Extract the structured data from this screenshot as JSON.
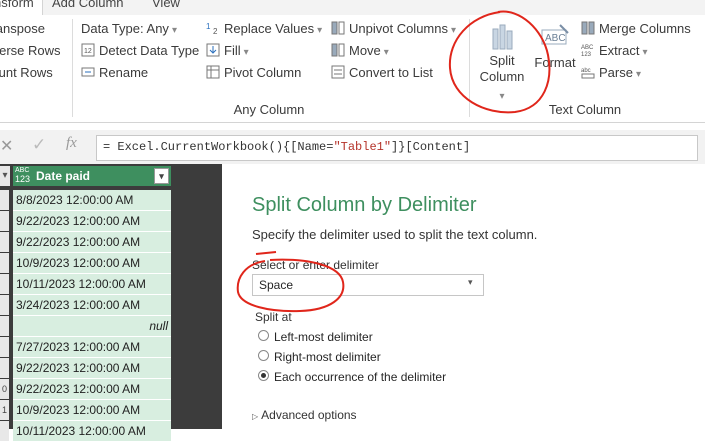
{
  "ribbon": {
    "tabs": [
      "Transform",
      "Add Column",
      "View"
    ],
    "left_items": [
      "Transpose",
      "Reverse Rows",
      "Count Rows"
    ],
    "any_column": {
      "data_type": "Data Type: Any",
      "detect_data_type": "Detect Data Type",
      "rename": "Rename",
      "replace_values": "Replace Values",
      "fill": "Fill",
      "pivot_column": "Pivot Column",
      "unpivot_columns": "Unpivot Columns",
      "move": "Move",
      "convert_to_list": "Convert to List",
      "group_label": "Any Column"
    },
    "text_column": {
      "split_line1": "Split",
      "split_line2": "Column",
      "format": "Format",
      "merge_columns": "Merge Columns",
      "extract": "Extract",
      "parse": "Parse",
      "group_label": "Text Column"
    }
  },
  "formula_bar": {
    "prefix": "= Excel.CurrentWorkbook(){[Name=",
    "table_name": "\"Table1\"",
    "suffix": "]}[Content]"
  },
  "grid": {
    "type_badge_top": "ABC",
    "type_badge_bottom": "123",
    "column_header": "Date paid",
    "rows": [
      "8/8/2023 12:00:00 AM",
      "9/22/2023 12:00:00 AM",
      "9/22/2023 12:00:00 AM",
      "10/9/2023 12:00:00 AM",
      "10/11/2023 12:00:00 AM",
      "3/24/2023 12:00:00 AM",
      "null",
      "7/27/2023 12:00:00 AM",
      "9/22/2023 12:00:00 AM",
      "9/22/2023 12:00:00 AM",
      "10/9/2023 12:00:00 AM",
      "10/11/2023 12:00:00 AM"
    ]
  },
  "dialog": {
    "title": "Split Column by Delimiter",
    "description": "Specify the delimiter used to split the text column.",
    "select_label": "Select or enter delimiter",
    "delimiter_value": "Space",
    "split_at_label": "Split at",
    "options": [
      "Left-most delimiter",
      "Right-most delimiter",
      "Each occurrence of the delimiter"
    ],
    "selected_option_index": 2,
    "advanced_options": "Advanced options"
  },
  "colors": {
    "accent_green": "#3e8f5f",
    "cell_green": "#d8eee0",
    "dialog_title": "#3e8f5f",
    "annotation_red": "#e0261b"
  }
}
